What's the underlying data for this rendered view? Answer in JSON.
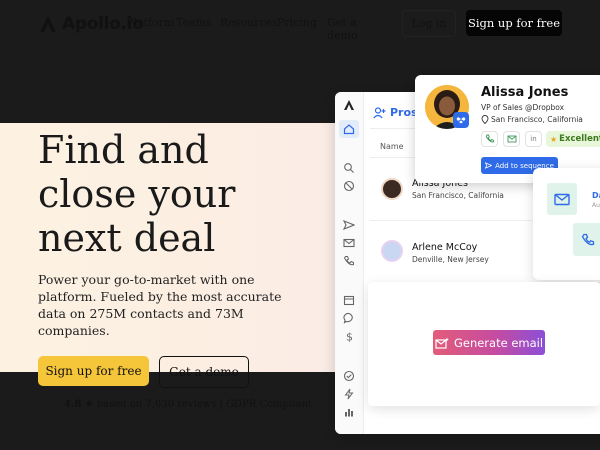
{
  "nav": {
    "logo_text": "Apollo.io",
    "items": [
      "Platform",
      "Teams",
      "Resources",
      "Pricing",
      "Get a demo"
    ],
    "login_label": "Log in",
    "signup_label": "Sign up for free"
  },
  "hero": {
    "headline_lines": [
      "Find and",
      "close your",
      "next deal"
    ],
    "subcopy_lines": [
      "Power your go-to-market with one",
      "platform. Fueled by the most accurate",
      "data on 275M contacts and 73M",
      "companies."
    ],
    "cta_primary": "Sign up for free",
    "cta_secondary": "Get a demo",
    "reviews_rating": "4.8",
    "reviews_text": "based on 7,030 reviews | GDPR Compliant"
  },
  "app": {
    "header_label": "Pros",
    "column_name": "Name",
    "rows": [
      {
        "name": "Alissa Jones",
        "location": "San Francisco, California"
      },
      {
        "name": "Arlene McCoy",
        "location": "Denville, New Jersey"
      }
    ]
  },
  "profile_card": {
    "name": "Alissa Jones",
    "role": "VP of Sales @Dropbox",
    "location": "San Francisco, California",
    "chip_in": "in",
    "rating_label": "Excellent",
    "sequence_label": "Add to sequence"
  },
  "side_card": {
    "text_da": "Da",
    "text_au": "Au"
  },
  "generate": {
    "label": "Generate email"
  },
  "colors": {
    "accent_yellow": "#f5c53a",
    "brand_blue": "#2f6be8",
    "dark_band": "#1b1b1b"
  }
}
